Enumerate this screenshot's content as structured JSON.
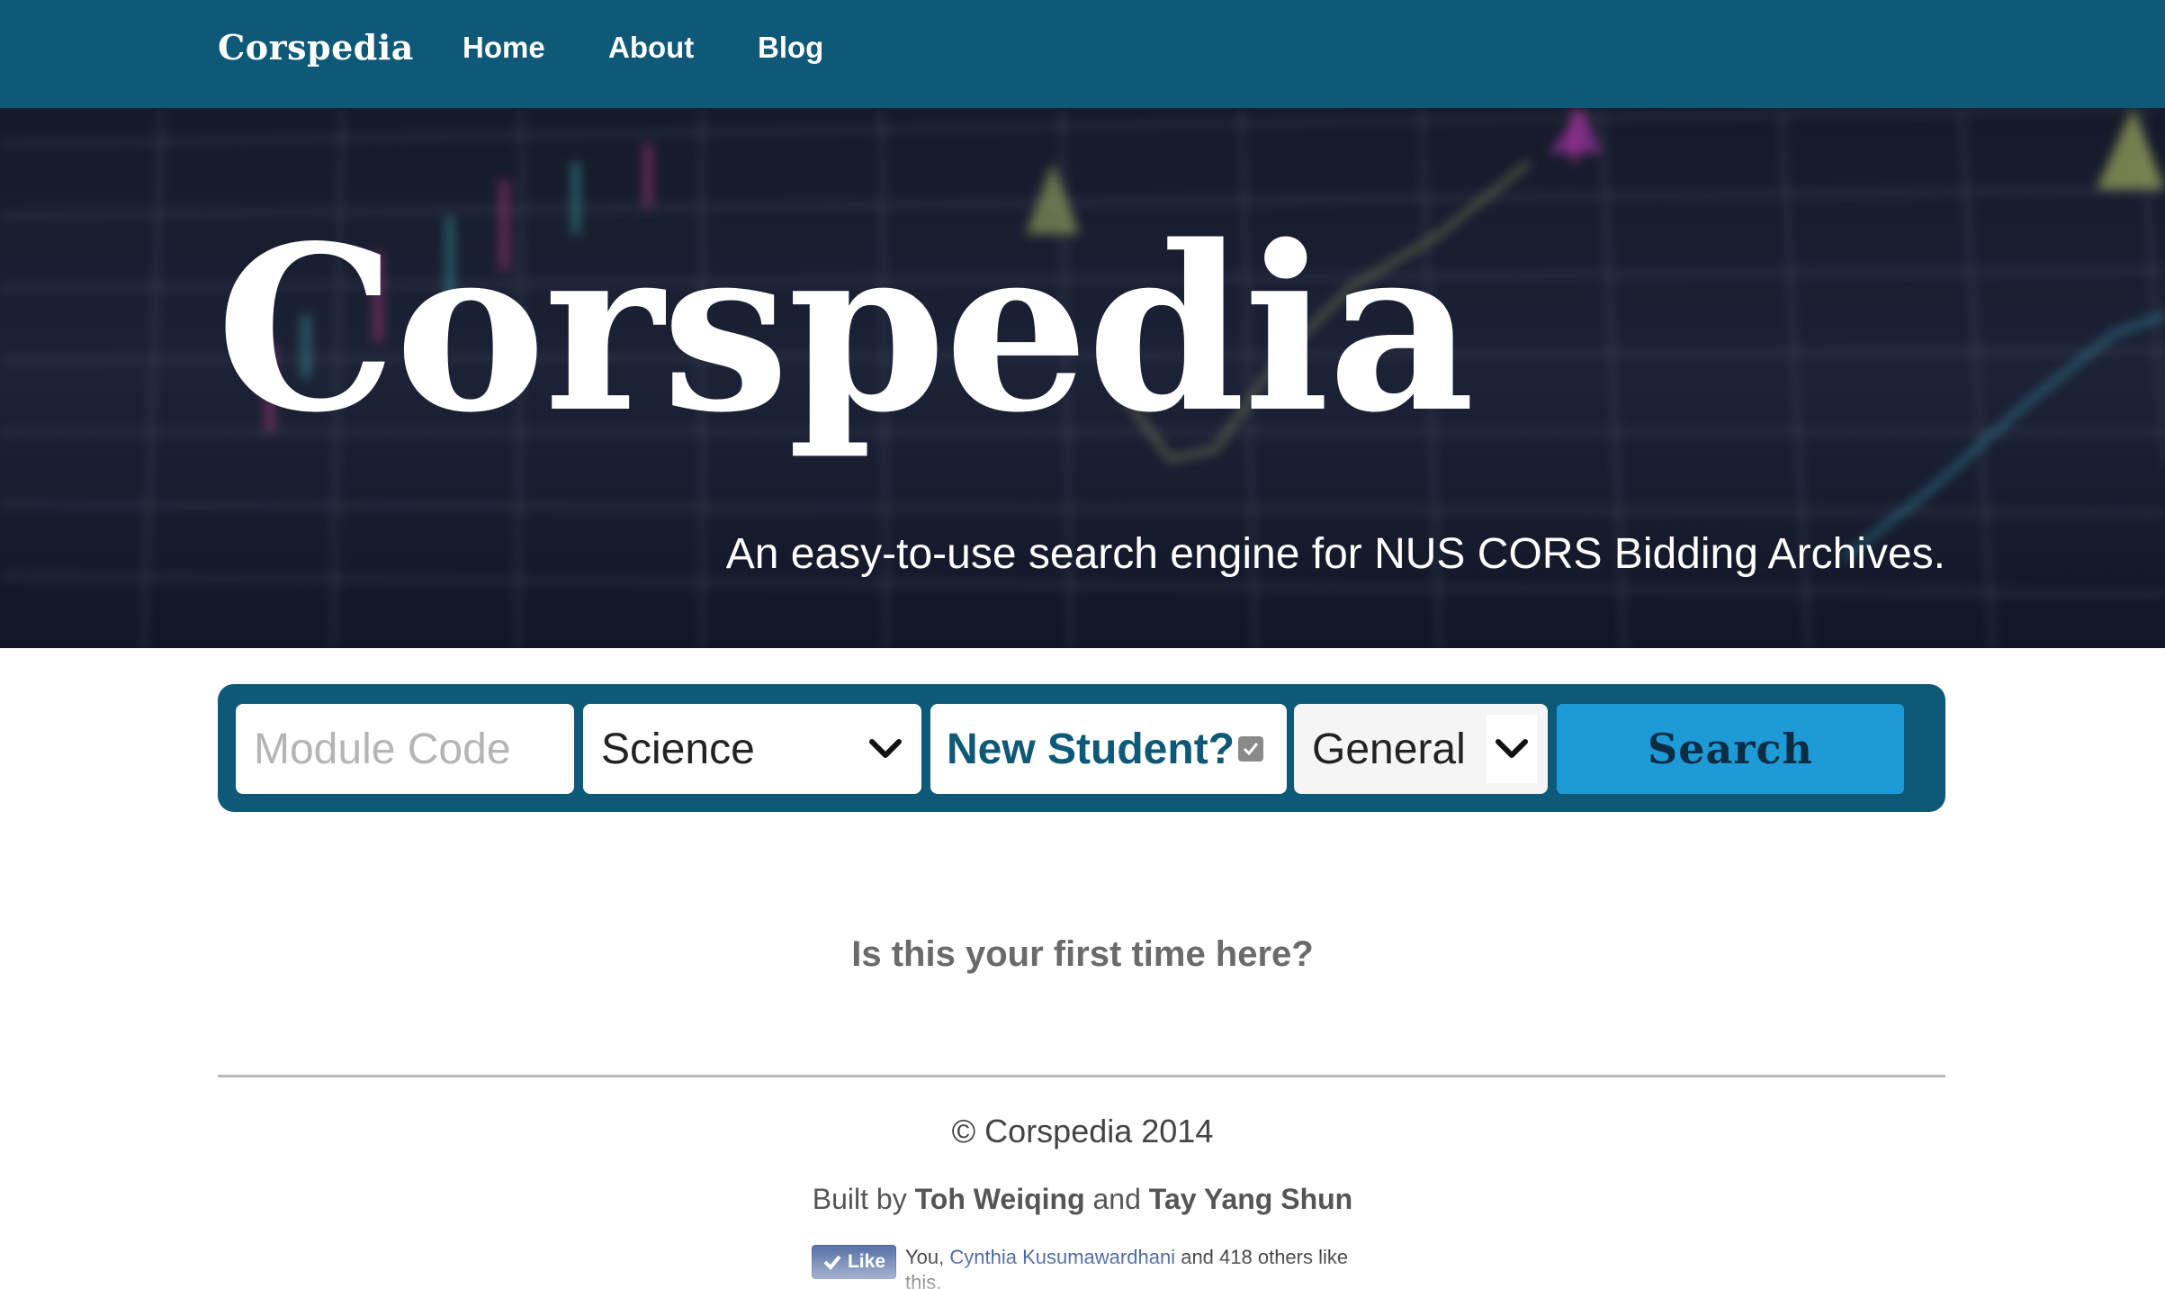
{
  "navbar": {
    "brand": "Corspedia",
    "links": [
      "Home",
      "About",
      "Blog"
    ]
  },
  "hero": {
    "title": "Corspedia",
    "tagline": "An easy-to-use search engine for NUS CORS Bidding Archives."
  },
  "search": {
    "module_placeholder": "Module Code",
    "faculty_selected": "Science",
    "new_student_label": "New Student?",
    "new_student_checked": true,
    "bid_type_selected": "General",
    "button_label": "Search"
  },
  "first_time": "Is this your first time here?",
  "footer": {
    "copyright": "© Corspedia 2014",
    "built_by_prefix": "Built by",
    "author1": "Toh Weiqing",
    "and": "and",
    "author2": "Tay Yang Shun"
  },
  "facebook": {
    "like_label": "Like",
    "likers_prefix": "You,",
    "friend": "Cynthia Kusumawardhani",
    "likers_suffix": "and 418 others like this."
  },
  "colors": {
    "navbar": "#0e5878",
    "search_button": "#1e9ad6",
    "new_student_text": "#0e5878"
  }
}
